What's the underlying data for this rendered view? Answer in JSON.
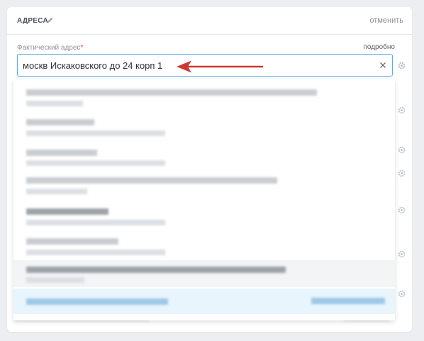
{
  "section": {
    "title": "АДРЕСА",
    "edit_icon": "pencil-icon",
    "cancel_label": "отменить"
  },
  "field": {
    "label": "Фактический адрес",
    "required_mark": "*",
    "details_label": "подробно",
    "value": "москв Искаковского до 24 корп 1",
    "clear_icon": "close-icon"
  },
  "row_icon": "gear-icon",
  "annotation": {
    "arrow_color": "#c93a32"
  },
  "suggestions_count": 8
}
